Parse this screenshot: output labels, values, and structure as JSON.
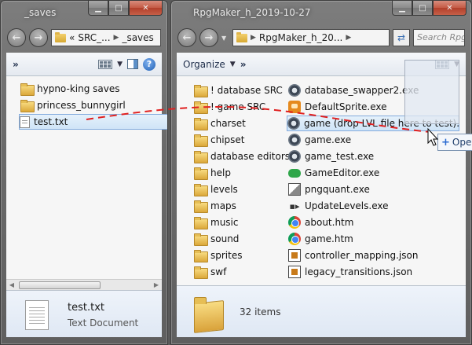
{
  "left_window": {
    "title": "_saves",
    "address": [
      "«",
      "SRC_...",
      "_saves"
    ],
    "toolbar_more": "»",
    "items": [
      {
        "name": "hypno-king saves",
        "type": "folder"
      },
      {
        "name": "princess_bunnygirl",
        "type": "folder"
      },
      {
        "name": "test.txt",
        "type": "text"
      }
    ],
    "details": {
      "name": "test.txt",
      "type": "Text Document"
    }
  },
  "right_window": {
    "title": "RpgMaker_h_2019-10-27",
    "address": "RpgMaker_h_20...",
    "search_placeholder": "Search Rpg",
    "toolbar": {
      "organize": "Organize",
      "more": "»"
    },
    "folders": [
      "! database SRC",
      "! game SRC",
      "charset",
      "chipset",
      "database editors",
      "help",
      "levels",
      "maps",
      "music",
      "sound",
      "sprites",
      "swf"
    ],
    "files": [
      {
        "name": "database_swapper2.exe",
        "icon": "gear-icon"
      },
      {
        "name": "DefaultSprite.exe",
        "icon": "sprite-icon"
      },
      {
        "name": "game (drop LVL file here to test).exe",
        "icon": "gear-icon"
      },
      {
        "name": "game.exe",
        "icon": "gear-icon"
      },
      {
        "name": "game_test.exe",
        "icon": "gear-icon"
      },
      {
        "name": "GameEditor.exe",
        "icon": "gamepad-icon"
      },
      {
        "name": "pngquant.exe",
        "icon": "image-icon"
      },
      {
        "name": "UpdateLevels.exe",
        "icon": "update-icon"
      },
      {
        "name": "about.htm",
        "icon": "chrome-icon"
      },
      {
        "name": "game.htm",
        "icon": "chrome-icon"
      },
      {
        "name": "controller_mapping.json",
        "icon": "json-icon"
      },
      {
        "name": "legacy_transitions.json",
        "icon": "json-icon"
      }
    ],
    "details": {
      "count": "32 items"
    }
  },
  "drag_tooltip": {
    "plus": "+",
    "label": "Ope"
  },
  "colors": {
    "drag_line": "#e02020",
    "selection": "#cfe4f7"
  }
}
